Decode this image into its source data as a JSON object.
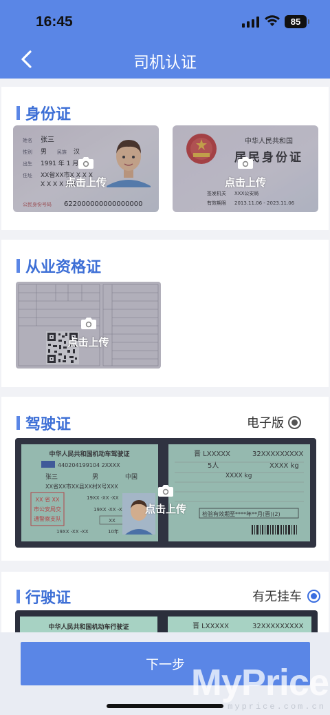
{
  "status_bar": {
    "time": "16:45",
    "battery": "85"
  },
  "nav": {
    "title": "司机认证"
  },
  "upload_label": "点击上传",
  "id_card": {
    "section_title": "身份证",
    "front": {
      "name_label": "姓名",
      "name": "张三",
      "gender_label": "性别",
      "gender": "男",
      "ethnic_label": "民族",
      "ethnic": "汉",
      "birth_label": "出生",
      "birth": "1991 年 1 月",
      "address_label": "住址",
      "address_1": "XX省XX市X X X X",
      "address_2": "X X X X X X",
      "id_label": "公民身份号码",
      "id_number": "622000000000000000"
    },
    "back": {
      "country": "中华人民共和国",
      "card_title": "居民身份证",
      "authority_label": "签发机关",
      "authority": "XXX公安局",
      "valid_label": "有效期限",
      "valid": "2013.11.06 - 2023.11.06"
    }
  },
  "qualification": {
    "section_title": "从业资格证"
  },
  "driver_license": {
    "section_title": "驾驶证",
    "option_label": "电子版",
    "option_selected": true,
    "header": "中华人民共和国机动车驾驶证",
    "license_no": "440204199104 2XXXX",
    "name": "张三",
    "gender": "男",
    "nationality": "中国",
    "address": "XX省XX市XX县XX村X号XXX",
    "birth": "19XX -XX -XX",
    "issue": "19XX -XX -XX",
    "stamp": [
      "XX 省 XX",
      "市公安局交",
      "通警察支队"
    ],
    "valid_from": "19XX -XX -XX",
    "valid_years": "10年",
    "class": "XX",
    "plate": "晋 LXXXXX",
    "file_no": "32XXXXXXXXX",
    "passengers": "5人",
    "total_mass": "XXXX kg",
    "curb_mass": "XXXX kg",
    "check_note": "检验有效期至****年**月(晋)(2)"
  },
  "vehicle_license": {
    "section_title": "行驶证",
    "option_label": "有无挂车",
    "option_selected": true,
    "header": "中华人民共和国机动车行驶证",
    "plate": "晋 LXXXXX",
    "file_no": "32XXXXXXXXX"
  },
  "footer": {
    "next_label": "下一步",
    "watermark": "MyPrice",
    "watermark_url": "myprice.com.cn"
  },
  "colors": {
    "accent": "#5a86e6",
    "title": "#3d6fd6",
    "radio": "#3a6ee0"
  }
}
